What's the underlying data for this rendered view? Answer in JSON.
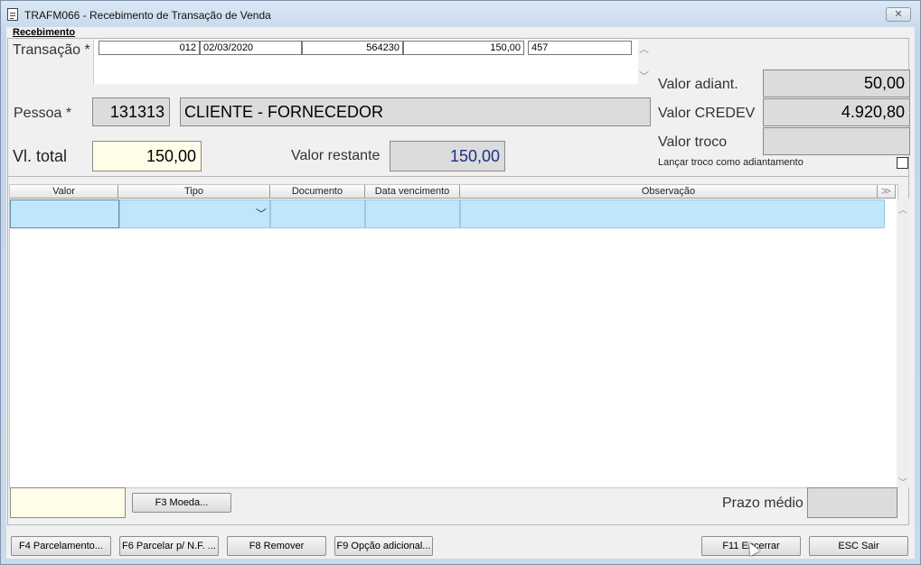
{
  "window": {
    "title": "TRAFM066 - Recebimento de Transação de Venda",
    "close_glyph": "✕"
  },
  "group": {
    "label": "Recebimento"
  },
  "transacao": {
    "label": "Transação *",
    "row": [
      "012",
      "02/03/2020",
      "564230",
      "150,00",
      "457"
    ]
  },
  "pessoa": {
    "label": "Pessoa *",
    "code": "131313",
    "name": "CLIENTE - FORNECEDOR"
  },
  "totals": {
    "vl_total_label": "Vl. total",
    "vl_total": "150,00",
    "valor_restante_label": "Valor restante",
    "valor_restante": "150,00",
    "valor_restante_color": "#1a2f8a"
  },
  "right_panel": {
    "adiant_label": "Valor adiant.",
    "adiant_value": "50,00",
    "credev_label": "Valor CREDEV",
    "credev_value": "4.920,80",
    "troco_label": "Valor troco",
    "troco_value": "",
    "lancar_label": "Lançar troco como adiantamento",
    "lancar_checked": false
  },
  "grid": {
    "columns": [
      "Valor",
      "Tipo",
      "Documento",
      "Data vencimento",
      "Observação"
    ]
  },
  "bottom": {
    "moeda_button": "F3 Moeda...",
    "prazo_label": "Prazo médio",
    "prazo_value": ""
  },
  "footer": {
    "parcelamento": "F4 Parcelamento...",
    "parcelar_nf": "F6 Parcelar p/ N.F. ...",
    "remover": "F8 Remover",
    "opcao": "F9 Opção adicional...",
    "encerrar": "F11 Encerrar",
    "sair": "ESC Sair"
  },
  "icons": {
    "title_icon": "document-icon",
    "dropdown": "chevron-down-icon",
    "scroll_up": "chevron-up-icon",
    "scroll_down": "chevron-down-icon"
  }
}
